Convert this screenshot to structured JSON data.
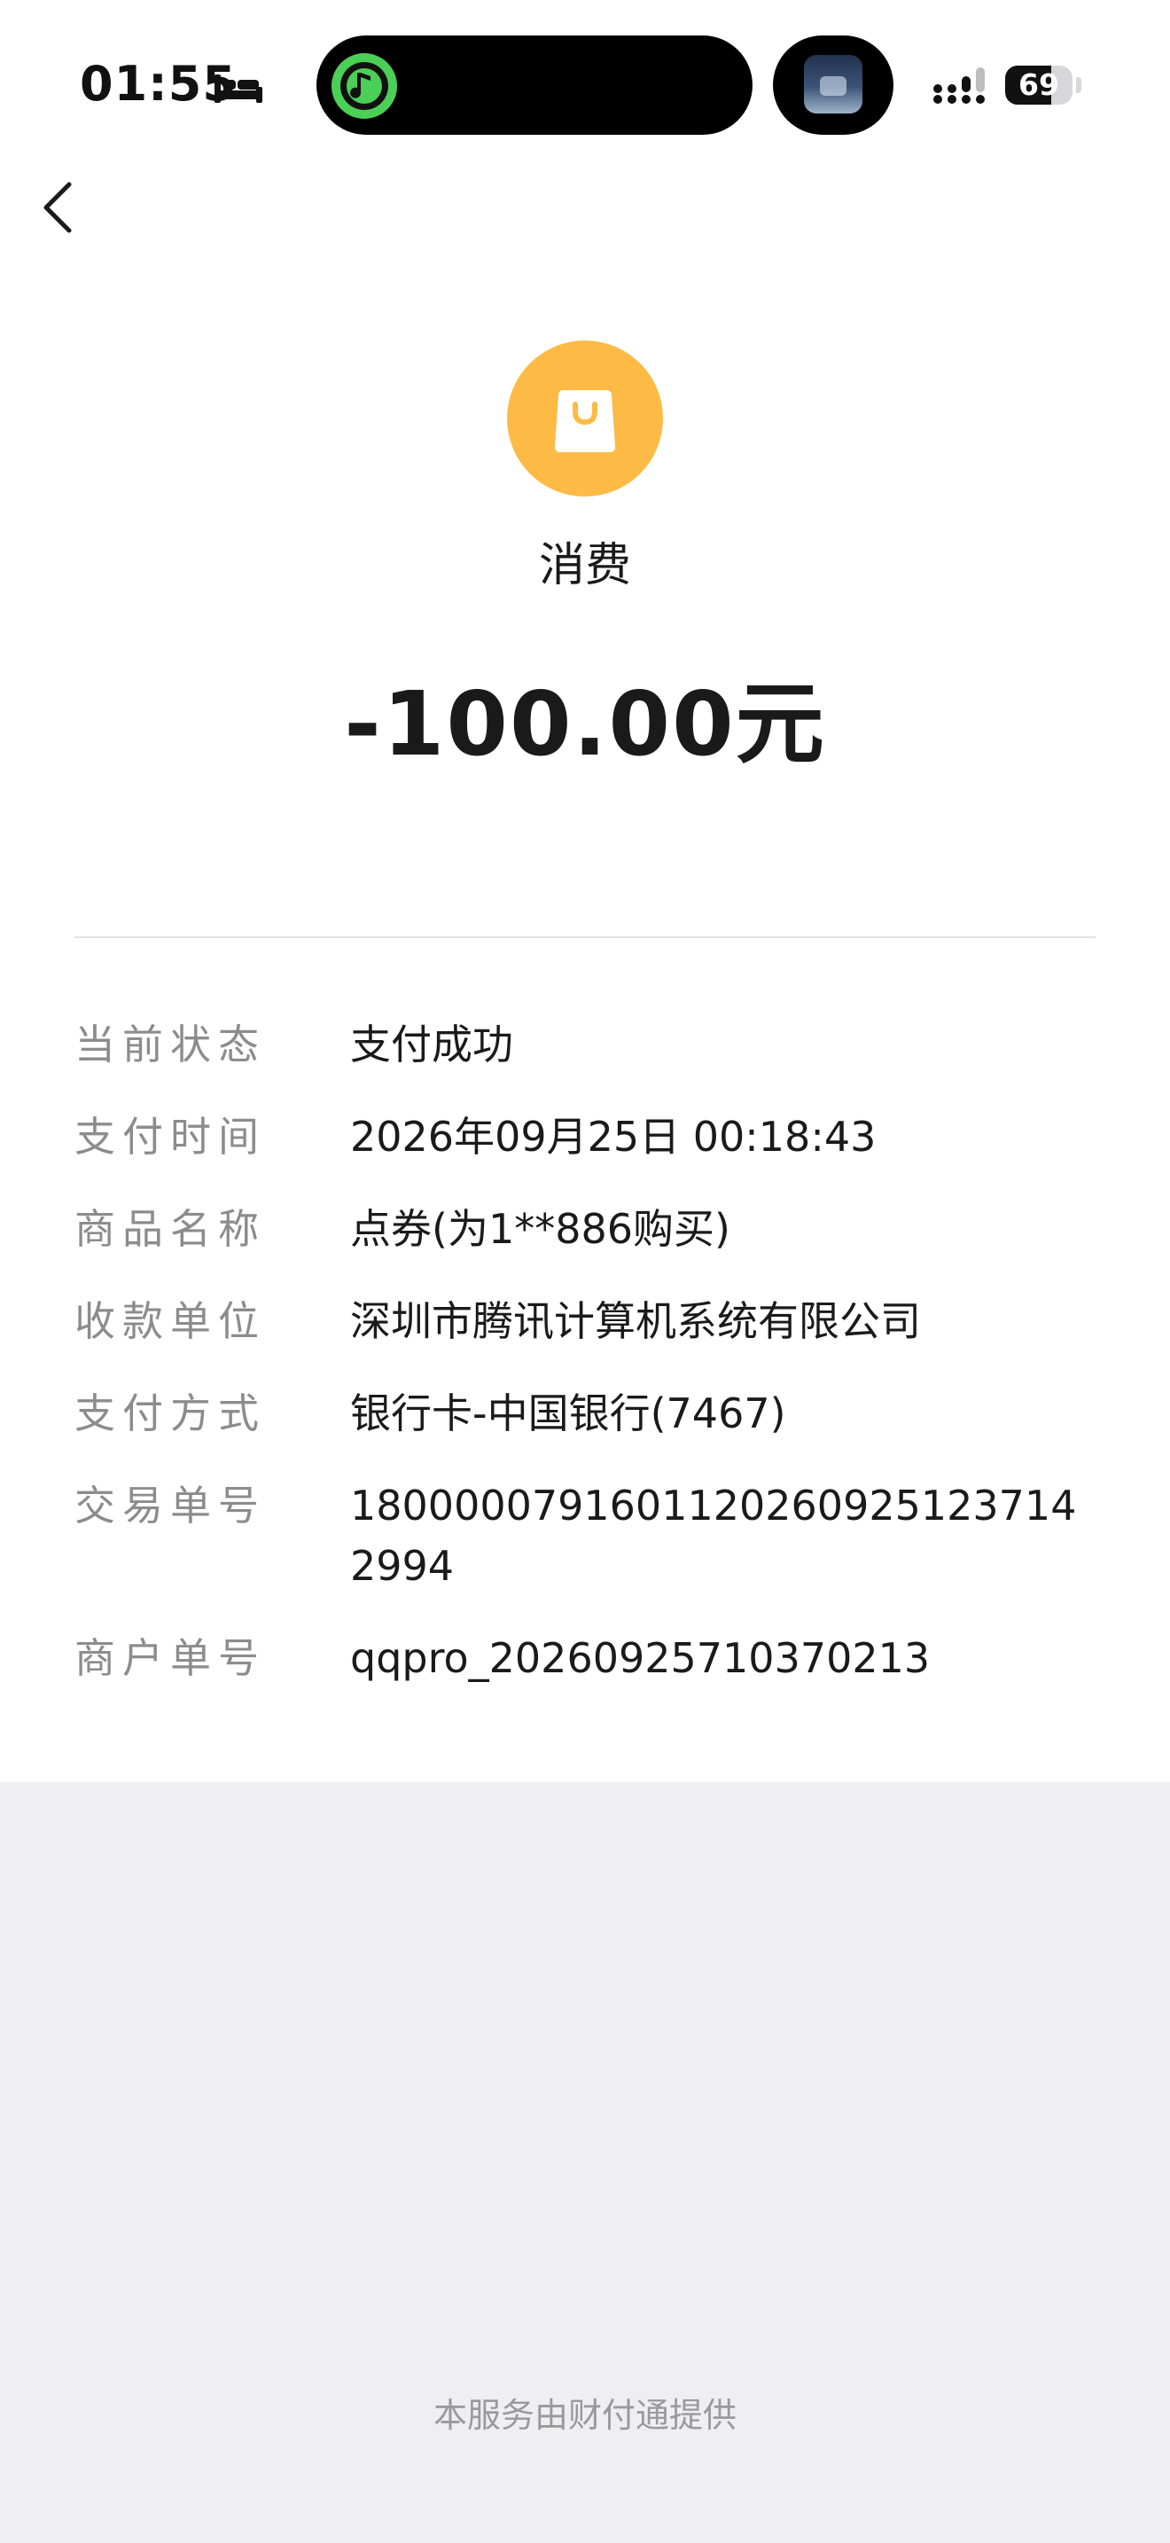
{
  "status_bar": {
    "time": "01:55",
    "battery_level": "69",
    "battery_fraction": 0.69
  },
  "header": {
    "back_icon": "chevron-left-icon",
    "icon": "shopping-bag-icon",
    "icon_color": "#fdbb45",
    "type_label": "消费",
    "amount": "-100.00元"
  },
  "details": [
    {
      "label": "当前状态",
      "value": "支付成功"
    },
    {
      "label": "支付时间",
      "value": "2026年09月25日 00:18:43"
    },
    {
      "label": "商品名称",
      "value": "点券(为1**886购买)"
    },
    {
      "label": "收款单位",
      "value": "深圳市腾讯计算机系统有限公司"
    },
    {
      "label": "支付方式",
      "value": "银行卡-中国银行(7467)"
    },
    {
      "label": "交易单号",
      "value": "18000007916011202609251237142994"
    },
    {
      "label": "商户单号",
      "value": "qqpro_20260925710370213"
    }
  ],
  "footer": {
    "text": "本服务由财付通提供"
  }
}
